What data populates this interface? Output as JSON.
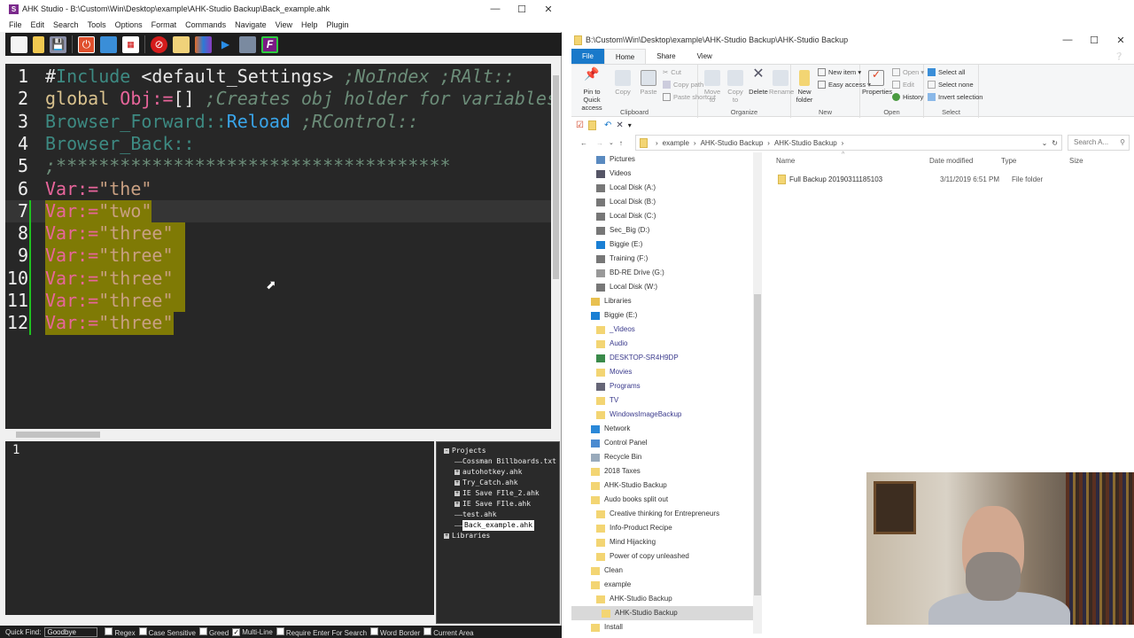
{
  "ahk": {
    "title": "AHK Studio - B:\\Custom\\Win\\Desktop\\example\\AHK-Studio Backup\\Back_example.ahk",
    "app_icon": "S",
    "menu": [
      "File",
      "Edit",
      "Search",
      "Tools",
      "Options",
      "Format",
      "Commands",
      "Navigate",
      "View",
      "Help",
      "Plugin"
    ],
    "toolbar": [
      "new-file-icon",
      "open-folder-icon",
      "save-icon",
      "power-icon",
      "window-icon",
      "tree-icon",
      "stop-icon",
      "notes-icon",
      "vs-icon",
      "run-icon",
      "debug-icon",
      "plugin-f-icon"
    ],
    "editor": {
      "lines": [
        {
          "n": "1",
          "tokens": [
            {
              "t": "#",
              "c": "tx"
            },
            {
              "t": "Include",
              "c": "lbl"
            },
            {
              "t": " <default_Settings> ",
              "c": "tx"
            },
            {
              "t": ";NoIndex ;RAlt::",
              "c": "cm"
            }
          ]
        },
        {
          "n": "2",
          "tokens": [
            {
              "t": "global ",
              "c": "kw"
            },
            {
              "t": "Obj",
              "c": "var"
            },
            {
              "t": ":=",
              "c": "var"
            },
            {
              "t": "[] ",
              "c": "tx"
            },
            {
              "t": ";Creates obj holder for variables",
              "c": "cm"
            }
          ]
        },
        {
          "n": "3",
          "tokens": [
            {
              "t": "Browser_Forward::",
              "c": "lbl"
            },
            {
              "t": "Reload",
              "c": "fn"
            },
            {
              "t": " ;RControl::",
              "c": "cm"
            }
          ]
        },
        {
          "n": "4",
          "tokens": [
            {
              "t": "Browser_Back::",
              "c": "lbl"
            }
          ]
        },
        {
          "n": "5",
          "tokens": [
            {
              "t": ";*************************************",
              "c": "cm"
            }
          ]
        },
        {
          "n": "6",
          "tokens": [
            {
              "t": "Var:=",
              "c": "var"
            },
            {
              "t": "\"the\"",
              "c": "str"
            }
          ]
        },
        {
          "n": "7",
          "tokens": [
            {
              "t": "Var:=",
              "c": "var"
            },
            {
              "t": "\"two\"",
              "c": "str"
            }
          ]
        },
        {
          "n": "8",
          "tokens": [
            {
              "t": "Var:=",
              "c": "var"
            },
            {
              "t": "\"three\"",
              "c": "str"
            }
          ]
        },
        {
          "n": "9",
          "tokens": [
            {
              "t": "Var:=",
              "c": "var"
            },
            {
              "t": "\"three\"",
              "c": "str"
            }
          ]
        },
        {
          "n": "10",
          "tokens": [
            {
              "t": "Var:=",
              "c": "var"
            },
            {
              "t": "\"three\"",
              "c": "str"
            }
          ]
        },
        {
          "n": "11",
          "tokens": [
            {
              "t": "Var:=",
              "c": "var"
            },
            {
              "t": "\"three\"",
              "c": "str"
            }
          ]
        },
        {
          "n": "12",
          "tokens": [
            {
              "t": "Var:=",
              "c": "var"
            },
            {
              "t": "\"three\"",
              "c": "str"
            }
          ]
        }
      ],
      "current_line": "7",
      "selected_lines": [
        "7",
        "8",
        "9",
        "10",
        "11",
        "12"
      ]
    },
    "output": {
      "line": "1"
    },
    "tree": {
      "projects": "Projects",
      "items": [
        {
          "label": "Cossman Billboards.txt",
          "expandable": false
        },
        {
          "label": "autohotkey.ahk",
          "expandable": true
        },
        {
          "label": "Try_Catch.ahk",
          "expandable": true
        },
        {
          "label": "IE Save FIle_2.ahk",
          "expandable": true
        },
        {
          "label": "IE Save FIle.ahk",
          "expandable": true
        },
        {
          "label": "test.ahk",
          "expandable": false
        },
        {
          "label": "Back_example.ahk",
          "expandable": false,
          "active": true
        }
      ],
      "libraries": "Libraries"
    },
    "status": {
      "quick_find_label": "Quick Find:",
      "quick_find_value": "Goodbye",
      "options": [
        {
          "label": "Regex",
          "checked": false
        },
        {
          "label": "Case Sensitive",
          "checked": false
        },
        {
          "label": "Greed",
          "checked": false
        },
        {
          "label": "Multi-Line",
          "checked": true
        },
        {
          "label": "Require Enter For Search",
          "checked": false
        },
        {
          "label": "Word Border",
          "checked": false
        },
        {
          "label": "Current Area",
          "checked": false
        }
      ]
    }
  },
  "explorer": {
    "title": "B:\\Custom\\Win\\Desktop\\example\\AHK-Studio Backup\\AHK-Studio Backup",
    "tabs": [
      "File",
      "Home",
      "Share",
      "View"
    ],
    "ribbon": {
      "clipboard": {
        "label": "Clipboard",
        "pin": "Pin to Quick access",
        "copy": "Copy",
        "paste": "Paste",
        "cut": "Cut",
        "copy_path": "Copy path",
        "paste_shortcut": "Paste shortcut"
      },
      "organize": {
        "label": "Organize",
        "move_to": "Move to",
        "copy_to": "Copy to",
        "delete": "Delete",
        "rename": "Rename"
      },
      "new": {
        "label": "New",
        "new_folder": "New folder",
        "new_item": "New item ▾",
        "easy_access": "Easy access ▾"
      },
      "open": {
        "label": "Open",
        "properties": "Properties",
        "open": "Open ▾",
        "edit": "Edit",
        "history": "History"
      },
      "select": {
        "label": "Select",
        "select_all": "Select all",
        "select_none": "Select none",
        "invert": "Invert selection"
      }
    },
    "breadcrumb": [
      "example",
      "AHK-Studio Backup",
      "AHK-Studio Backup"
    ],
    "search_placeholder": "Search A...",
    "nav": [
      {
        "label": "Pictures",
        "indent": 2,
        "icon": "pictures-icon"
      },
      {
        "label": "Videos",
        "indent": 2,
        "icon": "videos-icon"
      },
      {
        "label": "Local Disk (A:)",
        "indent": 2,
        "icon": "drive-icon"
      },
      {
        "label": "Local Disk (B:)",
        "indent": 2,
        "icon": "drive-icon"
      },
      {
        "label": "Local Disk (C:)",
        "indent": 2,
        "icon": "drive-icon"
      },
      {
        "label": "Sec_Big (D:)",
        "indent": 2,
        "icon": "drive-icon"
      },
      {
        "label": "Biggie (E:)",
        "indent": 2,
        "icon": "cloud-drive-icon"
      },
      {
        "label": "Training (F:)",
        "indent": 2,
        "icon": "drive-icon"
      },
      {
        "label": "BD-RE Drive (G:)",
        "indent": 2,
        "icon": "disc-drive-icon"
      },
      {
        "label": "Local Disk (W:)",
        "indent": 2,
        "icon": "drive-icon"
      },
      {
        "label": "Libraries",
        "indent": 1,
        "icon": "libraries-icon"
      },
      {
        "label": "Biggie (E:)",
        "indent": 1,
        "icon": "cloud-drive-icon"
      },
      {
        "label": "_Videos",
        "indent": 2,
        "icon": "folder-icon",
        "link": true
      },
      {
        "label": "Audio",
        "indent": 2,
        "icon": "folder-icon",
        "link": true
      },
      {
        "label": "DESKTOP-SR4H9DP",
        "indent": 2,
        "icon": "computer-icon",
        "link": true
      },
      {
        "label": "Movies",
        "indent": 2,
        "icon": "folder-icon",
        "link": true
      },
      {
        "label": "Programs",
        "indent": 2,
        "icon": "programs-icon",
        "link": true
      },
      {
        "label": "TV",
        "indent": 2,
        "icon": "folder-icon",
        "link": true
      },
      {
        "label": "WindowsImageBackup",
        "indent": 2,
        "icon": "folder-icon",
        "link": true
      },
      {
        "label": "Network",
        "indent": 1,
        "icon": "network-icon"
      },
      {
        "label": "Control Panel",
        "indent": 1,
        "icon": "control-panel-icon"
      },
      {
        "label": "Recycle Bin",
        "indent": 1,
        "icon": "recycle-bin-icon"
      },
      {
        "label": "2018 Taxes",
        "indent": 1,
        "icon": "folder-icon"
      },
      {
        "label": "AHK-Studio Backup",
        "indent": 1,
        "icon": "folder-icon"
      },
      {
        "label": "Audo books split out",
        "indent": 1,
        "icon": "folder-icon"
      },
      {
        "label": "Creative thinking for Entrepreneurs",
        "indent": 2,
        "icon": "folder-icon"
      },
      {
        "label": "Info-Product Recipe",
        "indent": 2,
        "icon": "folder-icon"
      },
      {
        "label": "Mind Hijacking",
        "indent": 2,
        "icon": "folder-icon"
      },
      {
        "label": "Power of copy unleashed",
        "indent": 2,
        "icon": "folder-icon"
      },
      {
        "label": "Clean",
        "indent": 1,
        "icon": "folder-icon"
      },
      {
        "label": "example",
        "indent": 1,
        "icon": "folder-icon"
      },
      {
        "label": "AHK-Studio Backup",
        "indent": 2,
        "icon": "folder-icon"
      },
      {
        "label": "AHK-Studio Backup",
        "indent": 3,
        "icon": "folder-icon",
        "selected": true
      },
      {
        "label": "Install",
        "indent": 1,
        "icon": "folder-icon"
      }
    ],
    "columns": [
      "Name",
      "Date modified",
      "Type",
      "Size"
    ],
    "files": [
      {
        "name": "Full Backup 20190311185103",
        "date": "3/11/2019 6:51 PM",
        "type": "File folder",
        "size": ""
      }
    ]
  },
  "colors": {
    "selection": "#7f7a05",
    "editor_bg": "#272727",
    "explorer_file_tab": "#1979ca"
  }
}
